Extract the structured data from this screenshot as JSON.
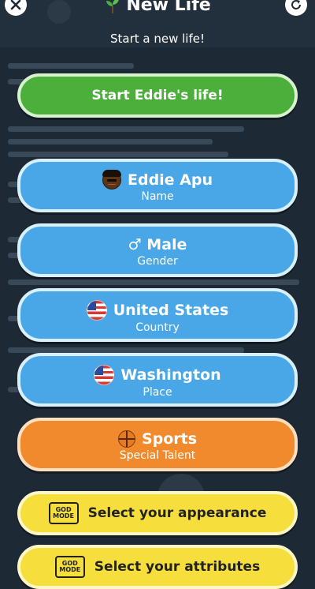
{
  "header": {
    "title": "New Life",
    "subtitle": "Start a new life!"
  },
  "start_button": {
    "label": "Start Eddie's life!"
  },
  "options": {
    "name": {
      "value": "Eddie Apu",
      "caption": "Name",
      "icon": "dark-skin-face-emoji"
    },
    "gender": {
      "value": "♂ Male",
      "caption": "Gender"
    },
    "country": {
      "value": "United States",
      "caption": "Country",
      "icon": "us-flag"
    },
    "place": {
      "value": "Washington",
      "caption": "Place",
      "icon": "us-flag"
    },
    "talent": {
      "value": "Sports",
      "caption": "Special Talent",
      "icon": "basketball"
    }
  },
  "god_mode": {
    "badge_text": "GOD MODE",
    "appearance_label": "Select your appearance",
    "attributes_label": "Select your attributes"
  },
  "colors": {
    "green": "#4cae3b",
    "blue": "#4aa7e7",
    "orange": "#f08a2c",
    "yellow": "#f6df3c",
    "background": "#1d2a35"
  }
}
